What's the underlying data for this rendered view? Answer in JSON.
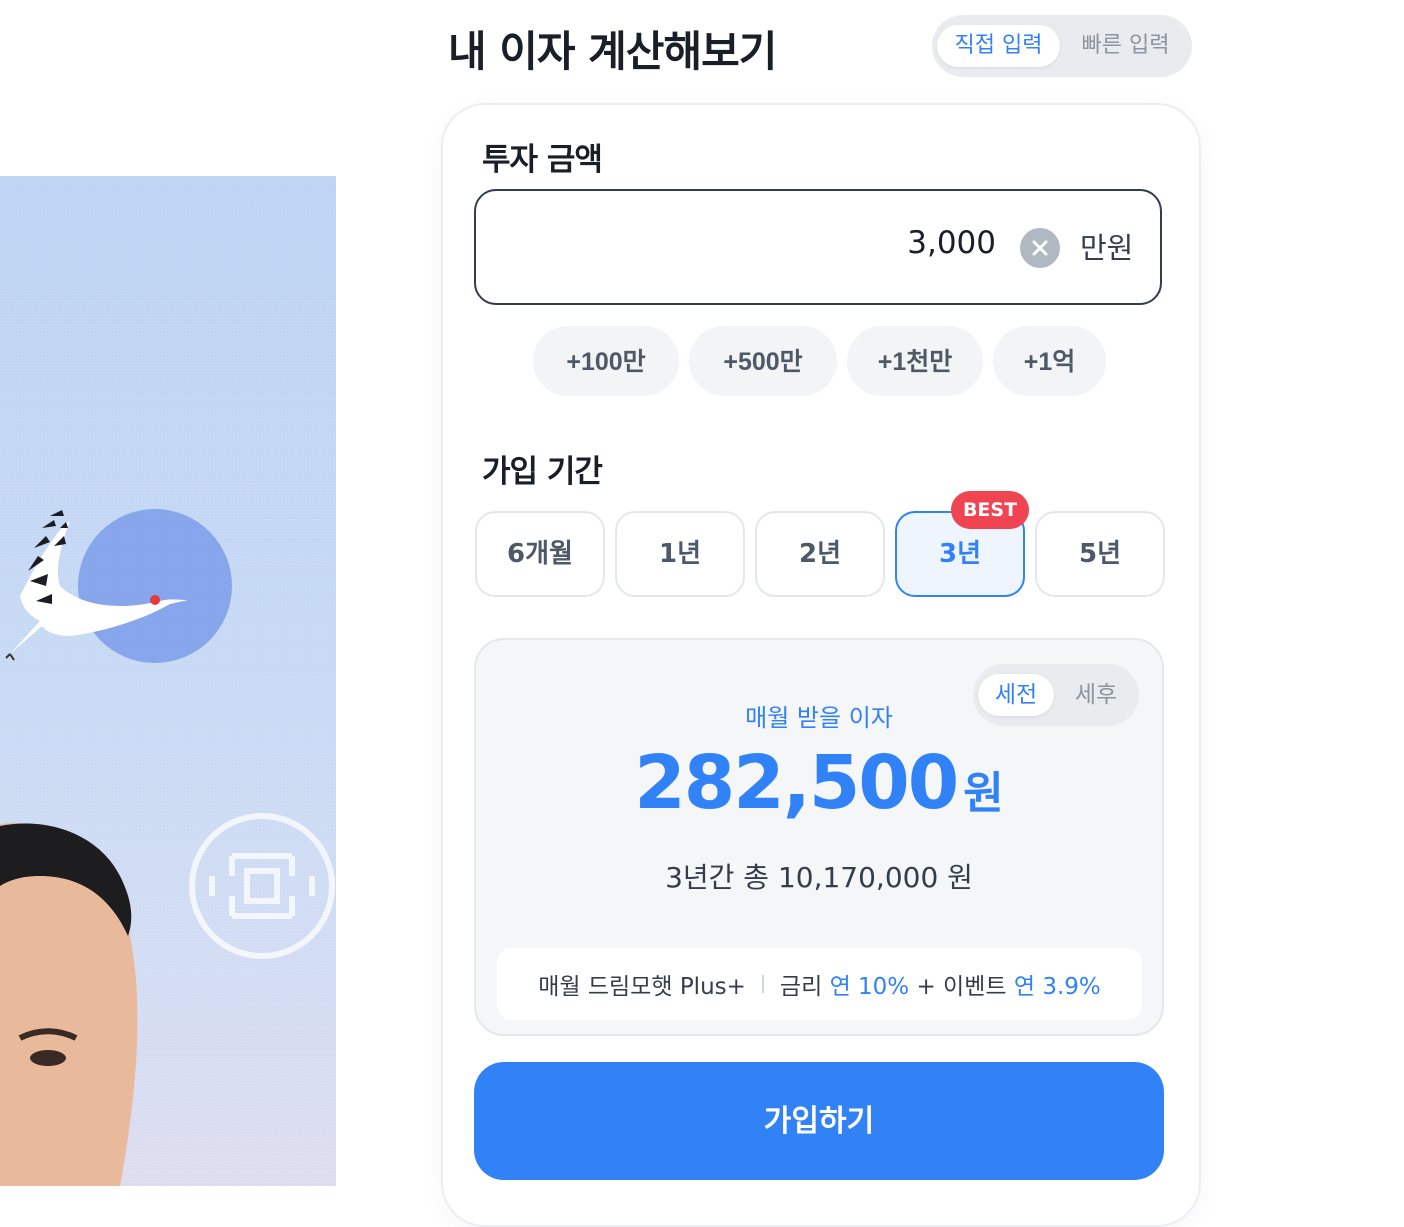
{
  "header": {
    "title": "내 이자 계산해보기",
    "input_mode_tabs": [
      {
        "label": "직접 입력",
        "active": true
      },
      {
        "label": "빠른 입력",
        "active": false
      }
    ]
  },
  "amount": {
    "label": "투자 금액",
    "value": "3,000",
    "unit": "만원",
    "quick_add": [
      "+100만",
      "+500만",
      "+1천만",
      "+1억"
    ]
  },
  "period": {
    "label": "가입 기간",
    "options": [
      "6개월",
      "1년",
      "2년",
      "3년",
      "5년"
    ],
    "selected": "3년",
    "best_badge": "BEST"
  },
  "result": {
    "tax_tabs": [
      {
        "label": "세전",
        "active": true
      },
      {
        "label": "세후",
        "active": false
      }
    ],
    "monthly_label": "매월 받을 이자",
    "monthly_value": "282,500",
    "monthly_unit": "원",
    "total_text": "3년간 총 10,170,000 원",
    "product_name": "매월 드림모햇 Plus+",
    "rate_label": "금리",
    "rate_value": "연 10%",
    "event_label": "+ 이벤트",
    "event_value": "연 3.9%"
  },
  "cta": {
    "label": "가입하기"
  },
  "colors": {
    "accent": "#3182f6",
    "badge": "#f04452",
    "text": "#191f28"
  }
}
